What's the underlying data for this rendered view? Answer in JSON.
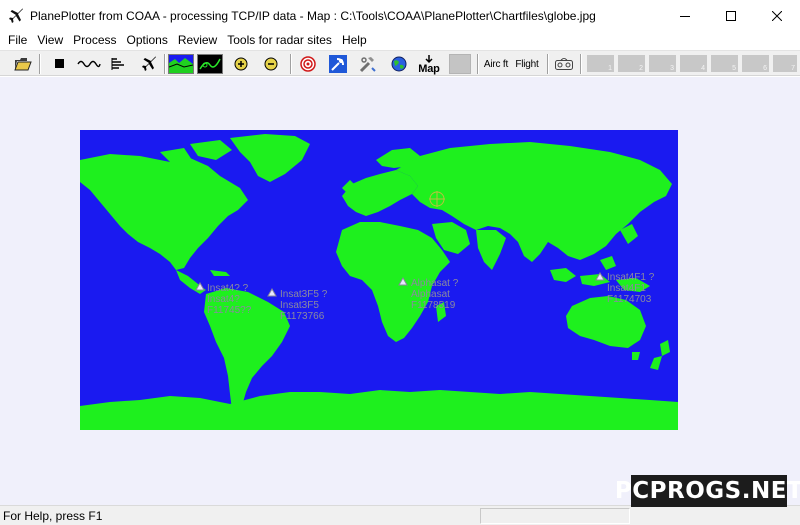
{
  "window": {
    "title": "PlanePlotter from COAA - processing TCP/IP data - Map : C:\\Tools\\COAA\\PlanePlotter\\Chartfiles\\globe.jpg",
    "icon": "airplane-icon"
  },
  "menu": {
    "items": [
      "File",
      "View",
      "Process",
      "Options",
      "Review",
      "Tools for radar sites",
      "Help"
    ]
  },
  "toolbar": {
    "map_label": "Map",
    "aircraft_label": "Airc ft",
    "flight_label": "Flight",
    "slots": [
      "1",
      "2",
      "3",
      "4",
      "5",
      "6",
      "7"
    ]
  },
  "satellites": [
    {
      "name": "Insat4F1 ?",
      "line2": "Insat4F1",
      "line3": "F1174703"
    },
    {
      "name": "Insat4? ?",
      "line2": "Insat4?",
      "line3": "F11745??"
    },
    {
      "name": "Insat3F5 ?",
      "line2": "Insat3F5",
      "line3": "F1173766"
    },
    {
      "name": "Alphasat ?",
      "line2": "Alphasat",
      "line3": "F1178519"
    }
  ],
  "status": {
    "help_text": "For Help, press F1"
  },
  "watermark": {
    "text": "PCPROGS.NET"
  },
  "colors": {
    "ocean": "#1a1af0",
    "land": "#1ef01e",
    "workspace": "#f0f0fb"
  }
}
